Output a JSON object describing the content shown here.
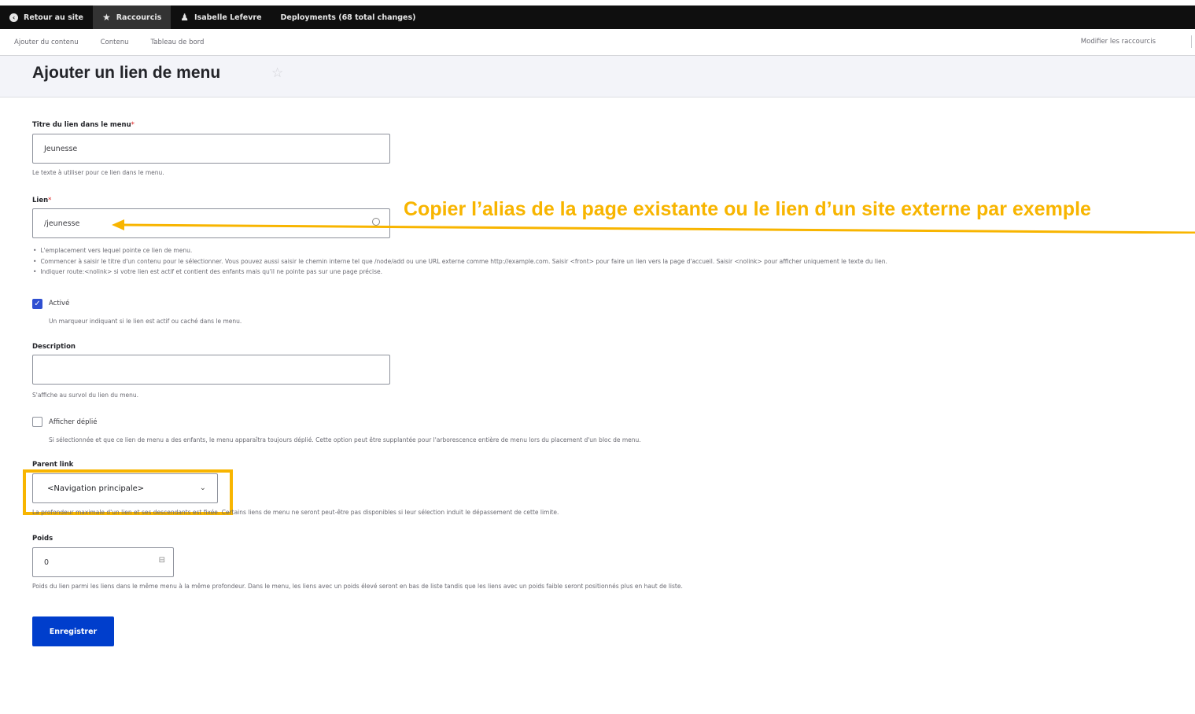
{
  "toolbar": {
    "back": "Retour au site",
    "shortcuts": "Raccourcis",
    "user": "Isabelle Lefevre",
    "deployments": "Deployments (68 total changes)"
  },
  "tray": {
    "items": [
      "Ajouter du contenu",
      "Contenu",
      "Tableau de bord"
    ],
    "edit_shortcuts": "Modifier les raccourcis"
  },
  "page": {
    "title": "Ajouter un lien de menu"
  },
  "form": {
    "title": {
      "label": "Titre du lien dans le menu",
      "value": "Jeunesse",
      "help": "Le texte à utiliser pour ce lien dans le menu."
    },
    "link": {
      "label": "Lien",
      "value": "/jeunesse",
      "help": [
        "L'emplacement vers lequel pointe ce lien de menu.",
        "Commencer à saisir le titre d'un contenu pour le sélectionner. Vous pouvez aussi saisir le chemin interne tel que /node/add ou une URL externe comme http://example.com. Saisir <front> pour faire un lien vers la page d'accueil. Saisir <nolink> pour afficher uniquement le texte du lien.",
        "Indiquer route:<nolink> si votre lien est actif et contient des enfants mais qu'il ne pointe pas sur une page précise."
      ]
    },
    "enabled": {
      "label": "Activé",
      "help": "Un marqueur indiquant si le lien est actif ou caché dans le menu."
    },
    "description": {
      "label": "Description",
      "value": "",
      "help": "S'affiche au survol du lien du menu."
    },
    "expanded": {
      "label": "Afficher déplié",
      "help": "Si sélectionnée et que ce lien de menu a des enfants, le menu apparaîtra toujours déplié. Cette option peut être supplantée pour l'arborescence entière de menu lors du placement d'un bloc de menu."
    },
    "parent": {
      "label": "Parent link",
      "value": "<Navigation principale>",
      "help": "La profondeur maximale d'un lien et ses descendants est fixée. Certains liens de menu ne seront peut-être pas disponibles si leur sélection induit le dépassement de cette limite."
    },
    "weight": {
      "label": "Poids",
      "value": "0",
      "help": "Poids du lien parmi les liens dans le même menu à la même profondeur. Dans le menu, les liens avec un poids élevé seront en bas de liste tandis que les liens avec un poids faible seront positionnés plus en haut de liste."
    },
    "submit": "Enregistrer",
    "required_mark": "*"
  },
  "annotation": {
    "text": "Copier l’alias de la page existante ou le lien d’un site externe par exemple",
    "color": "#f8b500"
  },
  "colors": {
    "primary_button": "#003ecc",
    "checkbox": "#2f4fd1",
    "highlight": "#f8b500"
  }
}
